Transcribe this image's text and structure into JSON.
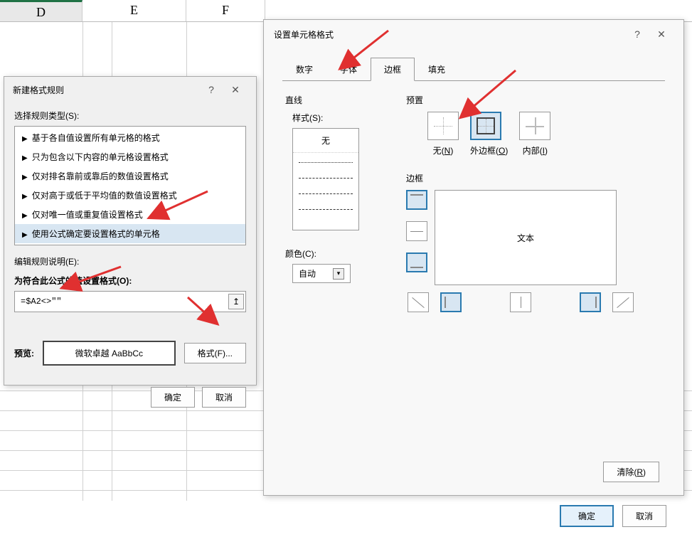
{
  "spreadsheet": {
    "cols": [
      "D",
      "E",
      "F"
    ]
  },
  "dlg1": {
    "title": "新建格式规则",
    "rule_type_label": "选择规则类型(S):",
    "rules": [
      "基于各自值设置所有单元格的格式",
      "只为包含以下内容的单元格设置格式",
      "仅对排名靠前或靠后的数值设置格式",
      "仅对高于或低于平均值的数值设置格式",
      "仅对唯一值或重复值设置格式",
      "使用公式确定要设置格式的单元格"
    ],
    "edit_label": "编辑规则说明(E):",
    "formula_label": "为符合此公式的值设置格式(O):",
    "formula_value": "=$A2<>\"\"",
    "preview_label": "预览:",
    "preview_text": "微软卓越 AaBbCc",
    "format_btn": "格式(F)...",
    "ok": "确定",
    "cancel": "取消"
  },
  "dlg2": {
    "title": "设置单元格格式",
    "tabs": [
      "数字",
      "字体",
      "边框",
      "填充"
    ],
    "line_section": "直线",
    "style_label": "样式(S):",
    "style_none": "无",
    "color_label": "颜色(C):",
    "color_value": "自动",
    "preset_section": "预置",
    "presets": {
      "none": "无(N)",
      "outer": "外边框(O)",
      "inner": "内部(I)"
    },
    "border_section": "边框",
    "preview_text": "文本",
    "clear_btn": "清除(R)",
    "ok": "确定",
    "cancel": "取消"
  }
}
